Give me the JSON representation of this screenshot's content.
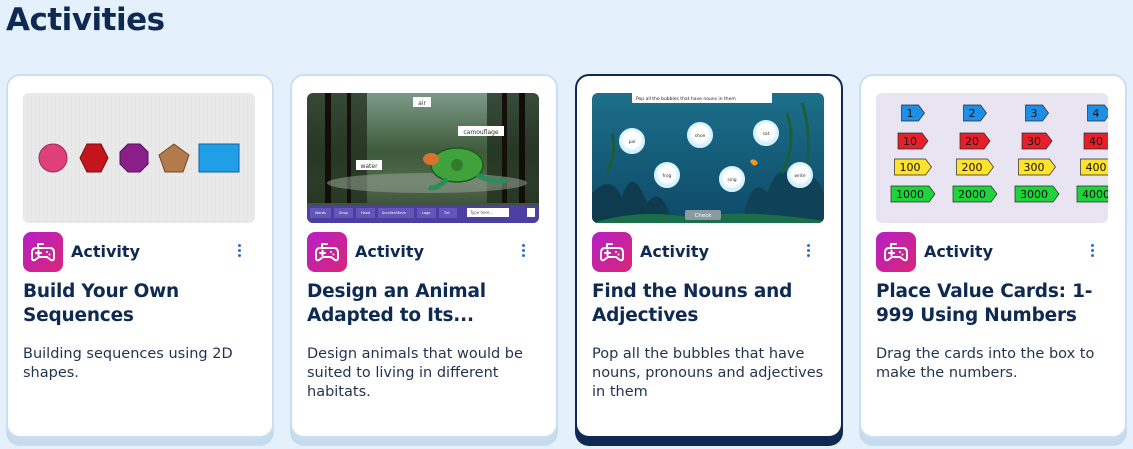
{
  "section": {
    "title": "Activities"
  },
  "cards": [
    {
      "type_label": "Activity",
      "title": "Build Your Own Sequences",
      "description": "Building sequences using 2D shapes.",
      "selected": false,
      "thumb": "shape-sequence"
    },
    {
      "type_label": "Activity",
      "title": "Design an Animal Adapted to Its...",
      "description": "Design animals that would be suited to living in different habitats.",
      "selected": false,
      "thumb": "animal-habitat",
      "thumb_labels": [
        "air",
        "camouflage",
        "water"
      ],
      "thumb_toolbar": [
        "Words",
        "Shop",
        "Hand",
        "Scroller/Move",
        "Logo",
        "Txt"
      ],
      "thumb_input_placeholder": "Type here..."
    },
    {
      "type_label": "Activity",
      "title": "Find the Nouns and Adjectives",
      "description": "Pop all the bubbles that have nouns, pronouns and adjectives in them",
      "selected": true,
      "thumb": "bubbles",
      "thumb_prompt": "Pop all the bubbles that have nouns in them",
      "thumb_bubbles": [
        "pal",
        "shoe",
        "sat",
        "frog",
        "sing",
        "write"
      ],
      "thumb_button": "Check"
    },
    {
      "type_label": "Activity",
      "title": "Place Value Cards: 1-999 Using Numbers",
      "description": "Drag the cards into the box to make the numbers.",
      "selected": false,
      "thumb": "place-value",
      "thumb_rows": [
        {
          "color": "#1e8fe6",
          "values": [
            "1",
            "2",
            "3",
            "4"
          ]
        },
        {
          "color": "#e5202a",
          "values": [
            "10",
            "20",
            "30",
            "40"
          ]
        },
        {
          "color": "#ffe22b",
          "values": [
            "100",
            "200",
            "300",
            "400"
          ]
        },
        {
          "color": "#1fd43a",
          "values": [
            "1000",
            "2000",
            "3000",
            "4000"
          ]
        }
      ]
    }
  ],
  "icons": {
    "badge": "gamepad-icon",
    "more": "more-vertical-icon"
  },
  "colors": {
    "background": "#e4f0fb",
    "title": "#0f2a52",
    "badge_from": "#b61fc4",
    "badge_to": "#d9267a",
    "selected_border": "#0f2a52"
  }
}
